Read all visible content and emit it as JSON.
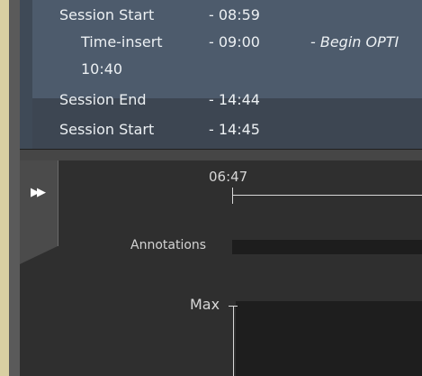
{
  "session_log": {
    "rows": [
      {
        "event": "Session Start",
        "time": "- 08:59",
        "note": ""
      },
      {
        "event": "Time-insert",
        "time": "- 09:00",
        "note": "- Begin OPTI"
      },
      {
        "event": "10:40",
        "time": "",
        "note": ""
      },
      {
        "event": "Session End",
        "time": "- 14:44",
        "note": ""
      },
      {
        "event": "Session Start",
        "time": "- 14:45",
        "note": ""
      }
    ]
  },
  "chart": {
    "expand_icon": "fast-forward-icon",
    "time_label": "06:47",
    "annotations_label": "Annotations",
    "max_label": "Max"
  }
}
